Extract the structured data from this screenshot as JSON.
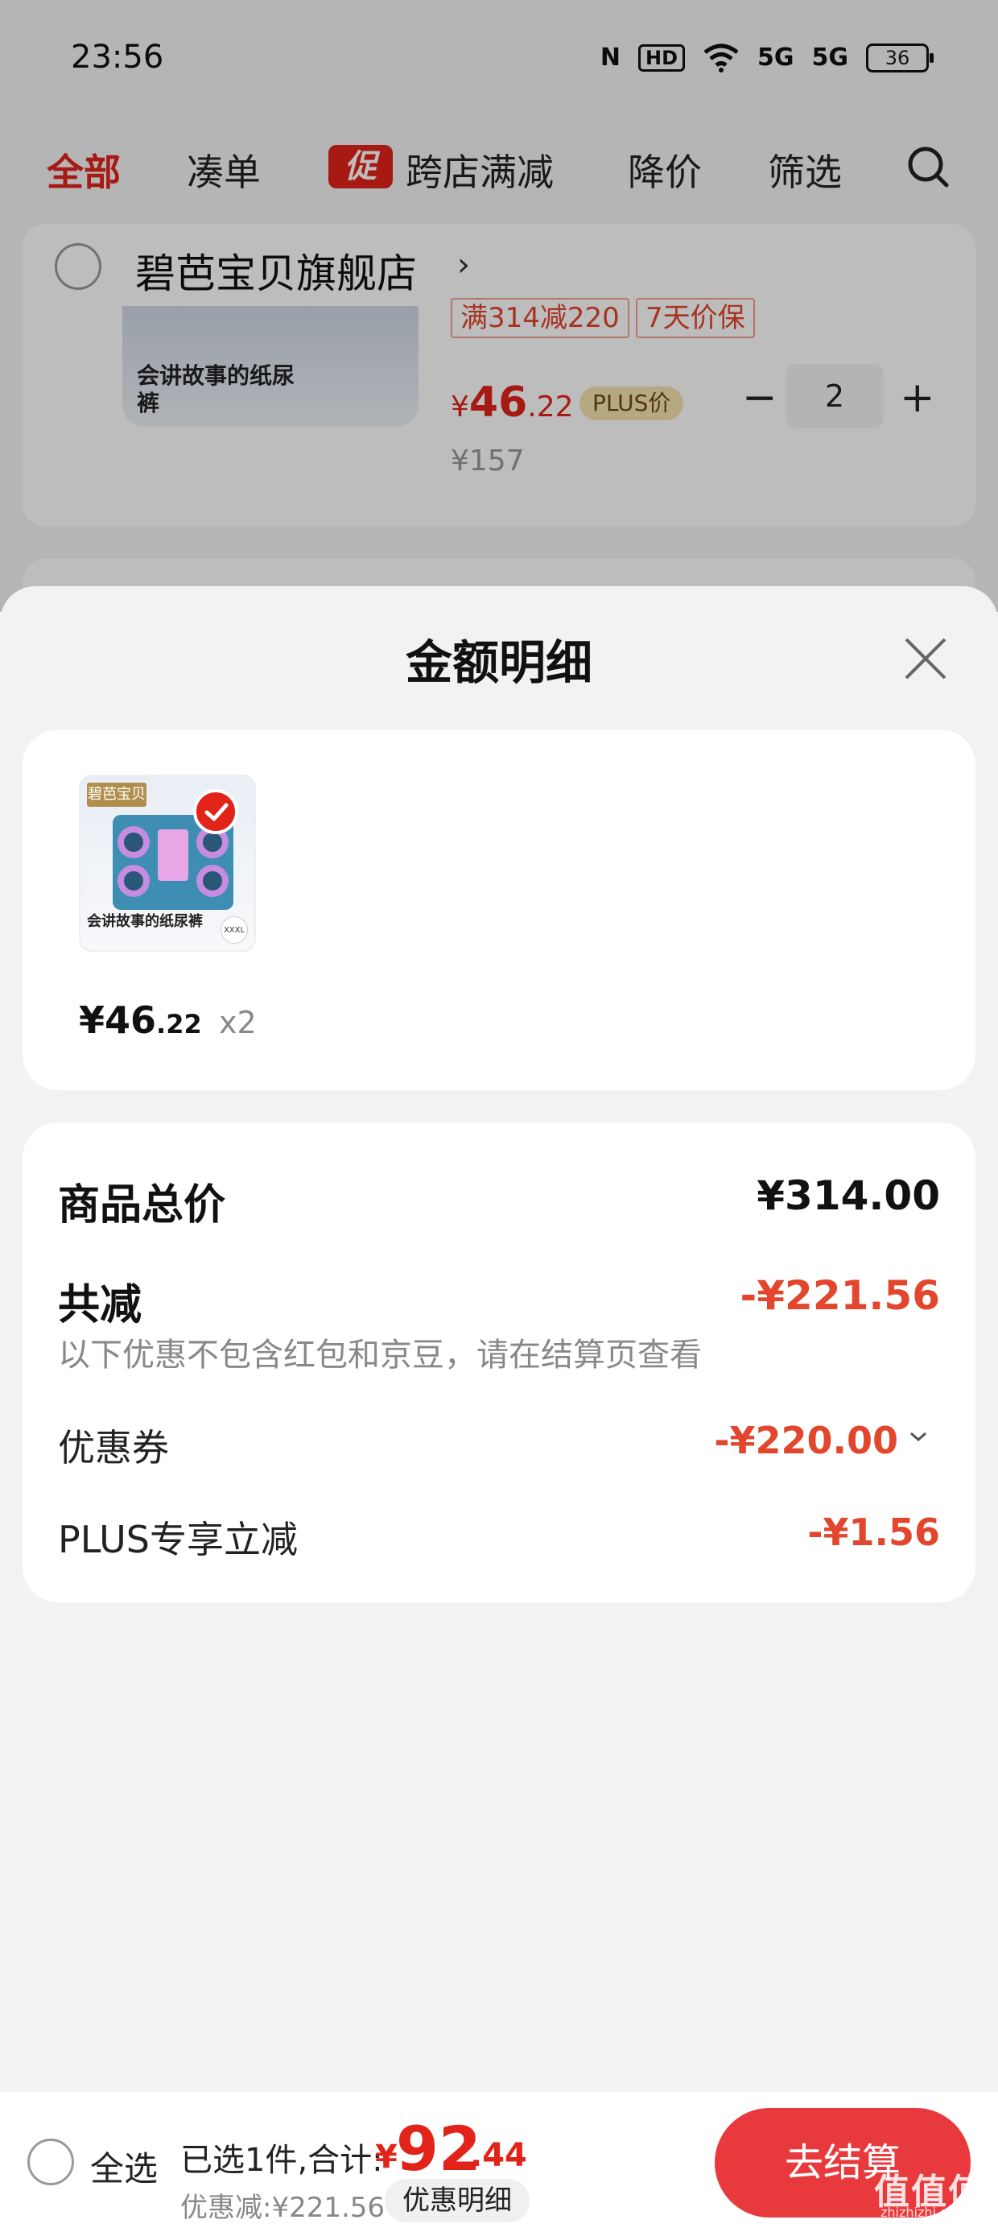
{
  "status_bar": {
    "time": "23:56",
    "nfc": "N",
    "hd": "HD",
    "signal1": "5G",
    "signal2": "5G",
    "battery": "36"
  },
  "tabs": {
    "all": "全部",
    "bundle": "凑单",
    "promo_badge": "促",
    "cross_store": "跨店满减",
    "price_drop": "降价",
    "filter": "筛选"
  },
  "store": {
    "name": "碧芭宝贝旗舰店",
    "chevron": "›",
    "product_caption_bg": "会讲故事的纸尿裤",
    "coupon_tag": "满314减220",
    "guarantee_tag": "7天价保",
    "price_currency": "¥",
    "price_int": "46",
    "price_dec": ".22",
    "plus_tag": "PLUS价",
    "minus": "−",
    "quantity": "2",
    "plus": "+",
    "original_price": "¥157"
  },
  "sheet": {
    "title": "金额明细",
    "item": {
      "brand_tag": "碧芭宝贝",
      "caption": "会讲故事的纸尿裤",
      "size_badge": "XXXL",
      "price_currency": "¥",
      "price_int": "46",
      "price_dec": ".22",
      "quantity": "x2"
    },
    "summary": {
      "total_label": "商品总价",
      "total_value": "¥314.00",
      "reduce_label": "共减",
      "reduce_value": "-¥221.56",
      "note": "以下优惠不包含红包和京豆，请在结算页查看",
      "coupon_label": "优惠券",
      "coupon_value": "-¥220.00",
      "plus_label": "PLUS专享立减",
      "plus_value": "-¥1.56"
    }
  },
  "bottom_bar": {
    "select_all": "全选",
    "selected_text": "已选1件,合计:",
    "total_currency": "¥",
    "total_int": "92",
    "total_dec": ".44",
    "discount_text": "优惠减:¥221.56",
    "detail_button": "优惠明细",
    "checkout": "去结算"
  },
  "watermark": {
    "text": "值值值",
    "url": "zhizhizhi.com"
  },
  "colors": {
    "accent_red": "#e2231a",
    "discount_red": "#e2462c",
    "checkout_button": "#e8393c"
  }
}
